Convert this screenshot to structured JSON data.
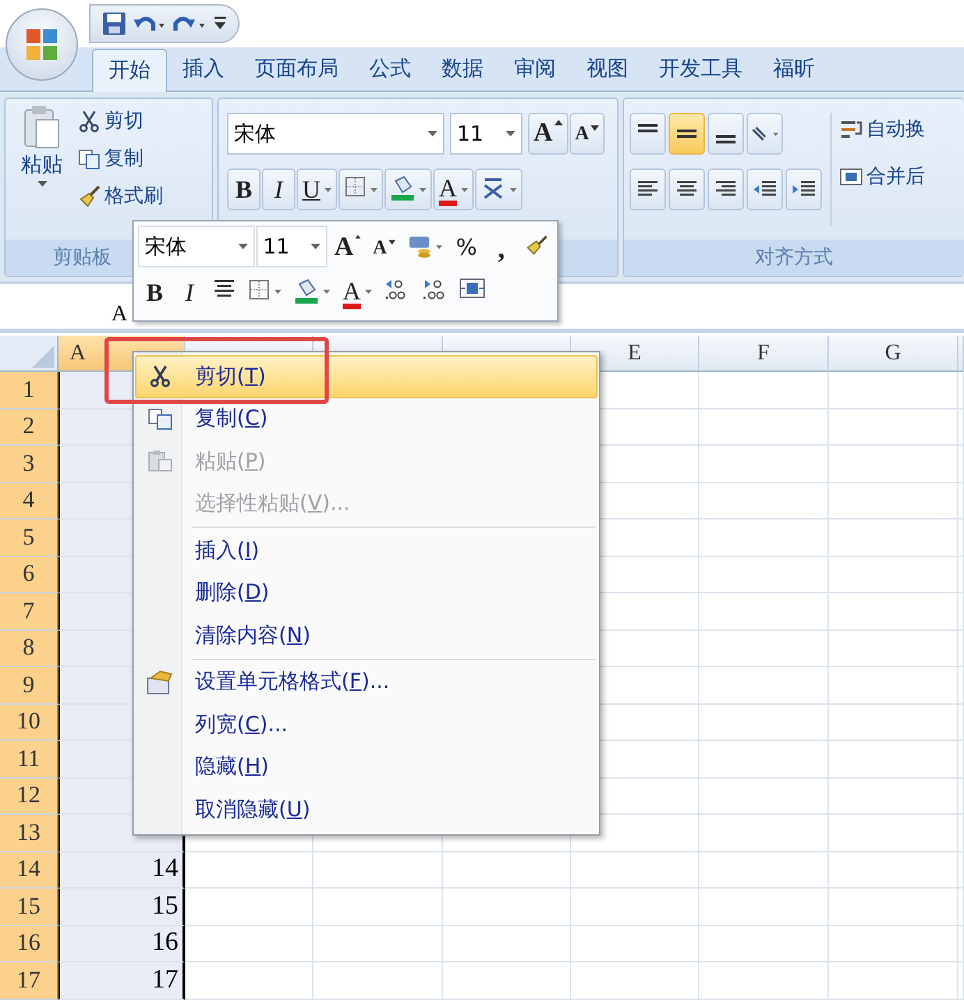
{
  "tabs": [
    {
      "label": "开始",
      "selected": true
    },
    {
      "label": "插入",
      "selected": false
    },
    {
      "label": "页面布局",
      "selected": false
    },
    {
      "label": "公式",
      "selected": false
    },
    {
      "label": "数据",
      "selected": false
    },
    {
      "label": "审阅",
      "selected": false
    },
    {
      "label": "视图",
      "selected": false
    },
    {
      "label": "开发工具",
      "selected": false
    },
    {
      "label": "福昕",
      "selected": false
    }
  ],
  "clipboard": {
    "paste": "粘贴",
    "cut": "剪切",
    "copy": "复制",
    "painter": "格式刷",
    "label": "剪贴板"
  },
  "font_group": {
    "font": "宋体",
    "size": "11",
    "row1": [
      {
        "kind": "grow",
        "label": "A"
      },
      {
        "kind": "shrink",
        "label": "A"
      }
    ],
    "row2": [
      {
        "kind": "bold",
        "label": "B"
      },
      {
        "kind": "italic",
        "label": "I"
      },
      {
        "kind": "underline",
        "label": "U"
      },
      {
        "kind": "borders"
      },
      {
        "kind": "fill"
      },
      {
        "kind": "font_color",
        "label": "A"
      },
      {
        "kind": "phonetic"
      }
    ]
  },
  "align_group": {
    "label": "对齐方式",
    "wrap": "自动换",
    "merge": "合并后",
    "row1": [
      {
        "kind": "top",
        "selected": false
      },
      {
        "kind": "middle",
        "selected": true
      },
      {
        "kind": "bottom",
        "selected": false
      },
      {
        "kind": "orientation",
        "selected": false
      }
    ],
    "row2": [
      {
        "kind": "left",
        "selected": false
      },
      {
        "kind": "center",
        "selected": false
      },
      {
        "kind": "right",
        "selected": false
      },
      {
        "kind": "outdent",
        "selected": false
      },
      {
        "kind": "indent",
        "selected": false
      }
    ]
  },
  "name_box": "A",
  "mini_toolbar": {
    "font": "宋体",
    "size": "11",
    "row1": [
      {
        "kind": "grow",
        "label": "A"
      },
      {
        "kind": "shrink",
        "label": "A"
      },
      {
        "kind": "accounting"
      },
      {
        "kind": "percent",
        "label": "%"
      },
      {
        "kind": "comma",
        "label": ","
      },
      {
        "kind": "painter"
      }
    ],
    "row2": [
      {
        "kind": "bold",
        "label": "B"
      },
      {
        "kind": "italic",
        "label": "I"
      },
      {
        "kind": "center"
      },
      {
        "kind": "borders"
      },
      {
        "kind": "fill"
      },
      {
        "kind": "font_color",
        "label": "A"
      },
      {
        "kind": "inc_decimal"
      },
      {
        "kind": "dec_decimal"
      },
      {
        "kind": "merge"
      }
    ]
  },
  "sheet": {
    "columns": [
      {
        "label": "A",
        "selected": true
      },
      {
        "selected": false
      },
      {
        "selected": false
      },
      {
        "selected": false
      },
      {
        "label": "E",
        "selected": false
      },
      {
        "label": "F",
        "selected": false
      },
      {
        "label": "G",
        "selected": false
      }
    ],
    "rows": [
      {
        "label": "1"
      },
      {
        "label": "2"
      },
      {
        "label": "3"
      },
      {
        "label": "4"
      },
      {
        "label": "5"
      },
      {
        "label": "6"
      },
      {
        "label": "7"
      },
      {
        "label": "8"
      },
      {
        "label": "9"
      },
      {
        "label": "10"
      },
      {
        "label": "11"
      },
      {
        "label": "12"
      },
      {
        "label": "13"
      },
      {
        "label": "14",
        "value": "14"
      },
      {
        "label": "15",
        "value": "15"
      },
      {
        "label": "16",
        "value": "16"
      },
      {
        "label": "17",
        "value": "17"
      }
    ]
  },
  "context_menu": [
    {
      "kind": "cut",
      "label": "剪切(T)",
      "selected": true,
      "disabled": false
    },
    {
      "kind": "copy",
      "label": "复制(C)",
      "selected": false,
      "disabled": false
    },
    {
      "kind": "paste",
      "label": "粘贴(P)",
      "selected": false,
      "disabled": true
    },
    {
      "kind": "command",
      "label": "选择性粘贴(V)...",
      "selected": false,
      "disabled": true
    },
    {
      "kind": "separator"
    },
    {
      "kind": "command",
      "label": "插入(I)",
      "selected": false,
      "disabled": false
    },
    {
      "kind": "command",
      "label": "删除(D)",
      "selected": false,
      "disabled": false
    },
    {
      "kind": "command",
      "label": "清除内容(N)",
      "selected": false,
      "disabled": false
    },
    {
      "kind": "separator"
    },
    {
      "kind": "format",
      "label": "设置单元格格式(F)...",
      "selected": false,
      "disabled": false
    },
    {
      "kind": "command",
      "label": "列宽(C)...",
      "selected": false,
      "disabled": false
    },
    {
      "kind": "command",
      "label": "隐藏(H)",
      "selected": false,
      "disabled": false
    },
    {
      "kind": "command",
      "label": "取消隐藏(U)",
      "selected": false,
      "disabled": false
    }
  ],
  "annotation": {
    "kind": "frame",
    "color": "#e04848"
  }
}
